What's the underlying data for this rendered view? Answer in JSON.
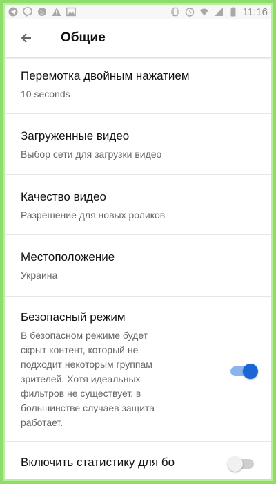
{
  "status_bar": {
    "left_icons": [
      "telegram-icon",
      "viber-icon",
      "skype-icon",
      "warning-icon",
      "gallery-icon"
    ],
    "right_icons": [
      "vibrate-icon",
      "alarm-icon",
      "wifi-icon",
      "signal-icon",
      "battery-icon"
    ],
    "time": "11:16"
  },
  "app_bar": {
    "back_icon": "arrow-left-icon",
    "title": "Общие"
  },
  "settings": {
    "double_tap": {
      "title": "Перемотка двойным нажатием",
      "value": "10 seconds"
    },
    "downloads": {
      "title": "Загруженные видео",
      "subtitle": "Выбор сети для загрузки видео"
    },
    "quality": {
      "title": "Качество видео",
      "subtitle": "Разрешение для новых роликов"
    },
    "location": {
      "title": "Местоположение",
      "value": "Украина"
    },
    "safe_mode": {
      "title": "Безопасный режим",
      "description_lines": [
        "В безопасном режиме будет",
        "скрыт контент, который не",
        "подходит некоторым группам",
        "зрителей. Хотя идеальных",
        "фильтров не существует, в",
        "большинстве случаев защита",
        "работает."
      ],
      "enabled": true
    },
    "statistics": {
      "title": "Включить статистику для бо",
      "enabled": false
    }
  },
  "colors": {
    "accent": "#1a66d6",
    "frame": "#8fdc6a"
  }
}
